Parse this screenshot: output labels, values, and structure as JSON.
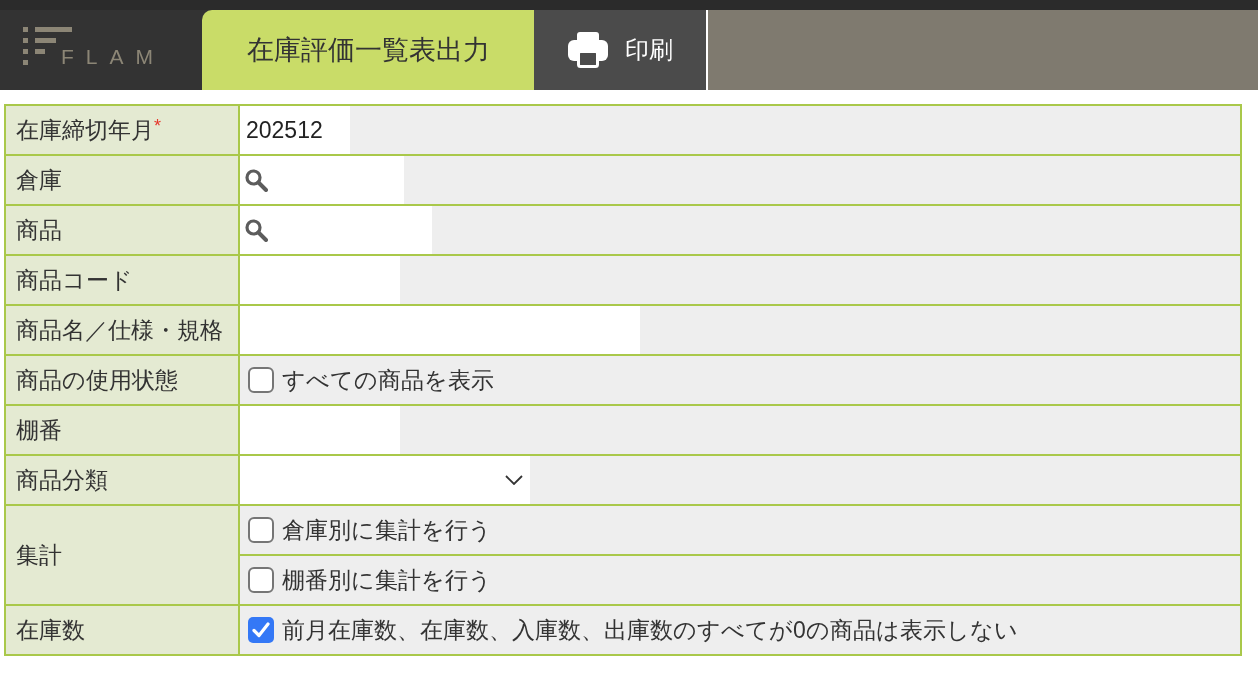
{
  "header": {
    "logo": "FLAM",
    "tabs": [
      {
        "label": "在庫評価一覧表出力",
        "selected": true
      }
    ],
    "actions": [
      {
        "label": "印刷",
        "kind": "print"
      }
    ]
  },
  "form": {
    "rows": [
      {
        "label": "在庫締切年月",
        "required_mark": "*",
        "kind": "text",
        "value": "202512"
      },
      {
        "label": "倉庫",
        "kind": "search"
      },
      {
        "label": "商品",
        "kind": "search"
      },
      {
        "label": "商品コード",
        "kind": "text"
      },
      {
        "label": "商品名／仕様・規格",
        "kind": "text"
      },
      {
        "label": "商品の使用状態",
        "kind": "checkboxes",
        "options": [
          {
            "label": "すべての商品を表示",
            "checked": false
          }
        ]
      },
      {
        "label": "棚番",
        "kind": "text"
      },
      {
        "label": "商品分類",
        "kind": "select"
      },
      {
        "label": "集計",
        "kind": "checkboxes",
        "options": [
          {
            "label": "倉庫別に集計を行う",
            "checked": false
          },
          {
            "label": "棚番別に集計を行う",
            "checked": false
          }
        ]
      },
      {
        "label": "在庫数",
        "kind": "checkboxes",
        "options": [
          {
            "label": "前月在庫数、在庫数、入庫数、出庫数のすべてが0の商品は表示しない",
            "checked": true
          }
        ]
      }
    ]
  }
}
